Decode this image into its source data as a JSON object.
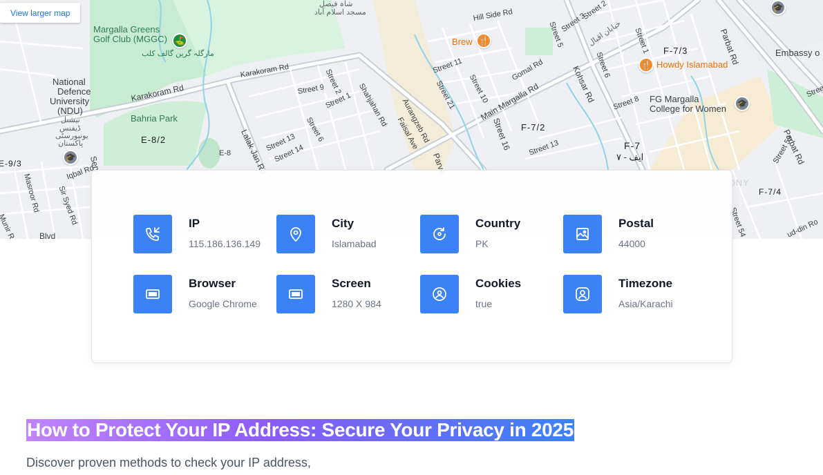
{
  "map": {
    "view_larger": "View larger map",
    "labels": {
      "margalla_greens": "Margalla Greens",
      "golf_club": "Golf Club (MGGC)",
      "golf_club_urdu": "مارگلہ گرین گالف کلب",
      "ndu_1": "National",
      "ndu_2": "Defence",
      "ndu_3": "University",
      "ndu_4": "(NDU)",
      "ndu_urdu_1": "نیشنل",
      "ndu_urdu_2": "ڈیفنس",
      "ndu_urdu_3": "یونیورسٹی",
      "ndu_urdu_4": "پاکستان",
      "bahria_park": "Bahria Park",
      "karakoram_rd": "Karakoram Rd",
      "karakoram_rd_2": "Karakoram Rd",
      "e82": "E-8/2",
      "e8": "E-8",
      "e93": "E-9/3",
      "lalak_jan": "Lalak Jan Rd",
      "street_13": "Street 13",
      "street_14": "Street 14",
      "street_6": "Street 6",
      "street_9": "Street 9",
      "street_2": "Street 2",
      "street_1": "Street 1",
      "shahjahan": "Shahjahan Rd",
      "faisal_ave": "Faisal Ave",
      "aurangzeb": "Aurangzeb Rd",
      "street_11": "Street 11",
      "street_21": "Street 21",
      "street_10": "Street 10",
      "brew": "Brew",
      "hill_side": "Hill Side Rd",
      "street_5": "Street 5",
      "street_3": "Street 3",
      "street_2b": "Street 2",
      "khayaban_urdu": "خیابان اقبال",
      "street_6b": "Street 6",
      "street_1b": "Street 1",
      "f73": "F-7/3",
      "gomal": "Gomal Rd",
      "main_margalla": "Main Margalla Rd",
      "kohsar": "Kohsar Rd",
      "street_16": "Street 16",
      "f72": "F-7/2",
      "street_13b": "Street 13",
      "street_8": "Street 8",
      "f7": "F-7",
      "f7_urdu": "ایف - ۷",
      "howdy": "Howdy Islamabad",
      "fg_margalla_1": "FG Margalla",
      "fg_margalla_2": "College for Women",
      "parbat_rd": "Parbat Rd",
      "parbat_rd_2": "Parbat Rd",
      "embassy": "Embassy o",
      "france_colony": "FRANCE COLONY",
      "f74": "F-7/4",
      "street_59": "Street 59",
      "street_54": "Street 54",
      "ud_din": "ud-din Ro",
      "shah_faisal_urdu_1": "شاہ فیصل",
      "shah_faisal_urdu_2": "مسجد اسلام آباد",
      "masroor": "Masroor Rd",
      "sir_syed": "Sir Syed Rd",
      "munir": "Munir Rd",
      "iqbal_rd": "Iqbal Rd",
      "blvd": "Blvd",
      "service": "Servi",
      "parvez": "Parve",
      "street_edge": "Stree"
    }
  },
  "info": {
    "items": [
      {
        "label": "IP",
        "value": "115.186.136.149",
        "icon": "phone-incoming-icon"
      },
      {
        "label": "City",
        "value": "Islamabad",
        "icon": "map-pin-icon"
      },
      {
        "label": "Country",
        "value": "PK",
        "icon": "globe-refresh-icon"
      },
      {
        "label": "Postal",
        "value": "44000",
        "icon": "image-mail-icon"
      },
      {
        "label": "Browser",
        "value": "Google Chrome",
        "icon": "browser-window-icon"
      },
      {
        "label": "Screen",
        "value": "1280 X 984",
        "icon": "screen-icon"
      },
      {
        "label": "Cookies",
        "value": "true",
        "icon": "cookie-user-icon"
      },
      {
        "label": "Timezone",
        "value": "Asia/Karachi",
        "icon": "user-frame-icon"
      }
    ],
    "tile_color": "#3b82f6"
  },
  "article": {
    "headline": "How to Protect Your IP Address: Secure Your Privacy in 2025",
    "intro": "Discover proven methods to check your IP address,"
  }
}
